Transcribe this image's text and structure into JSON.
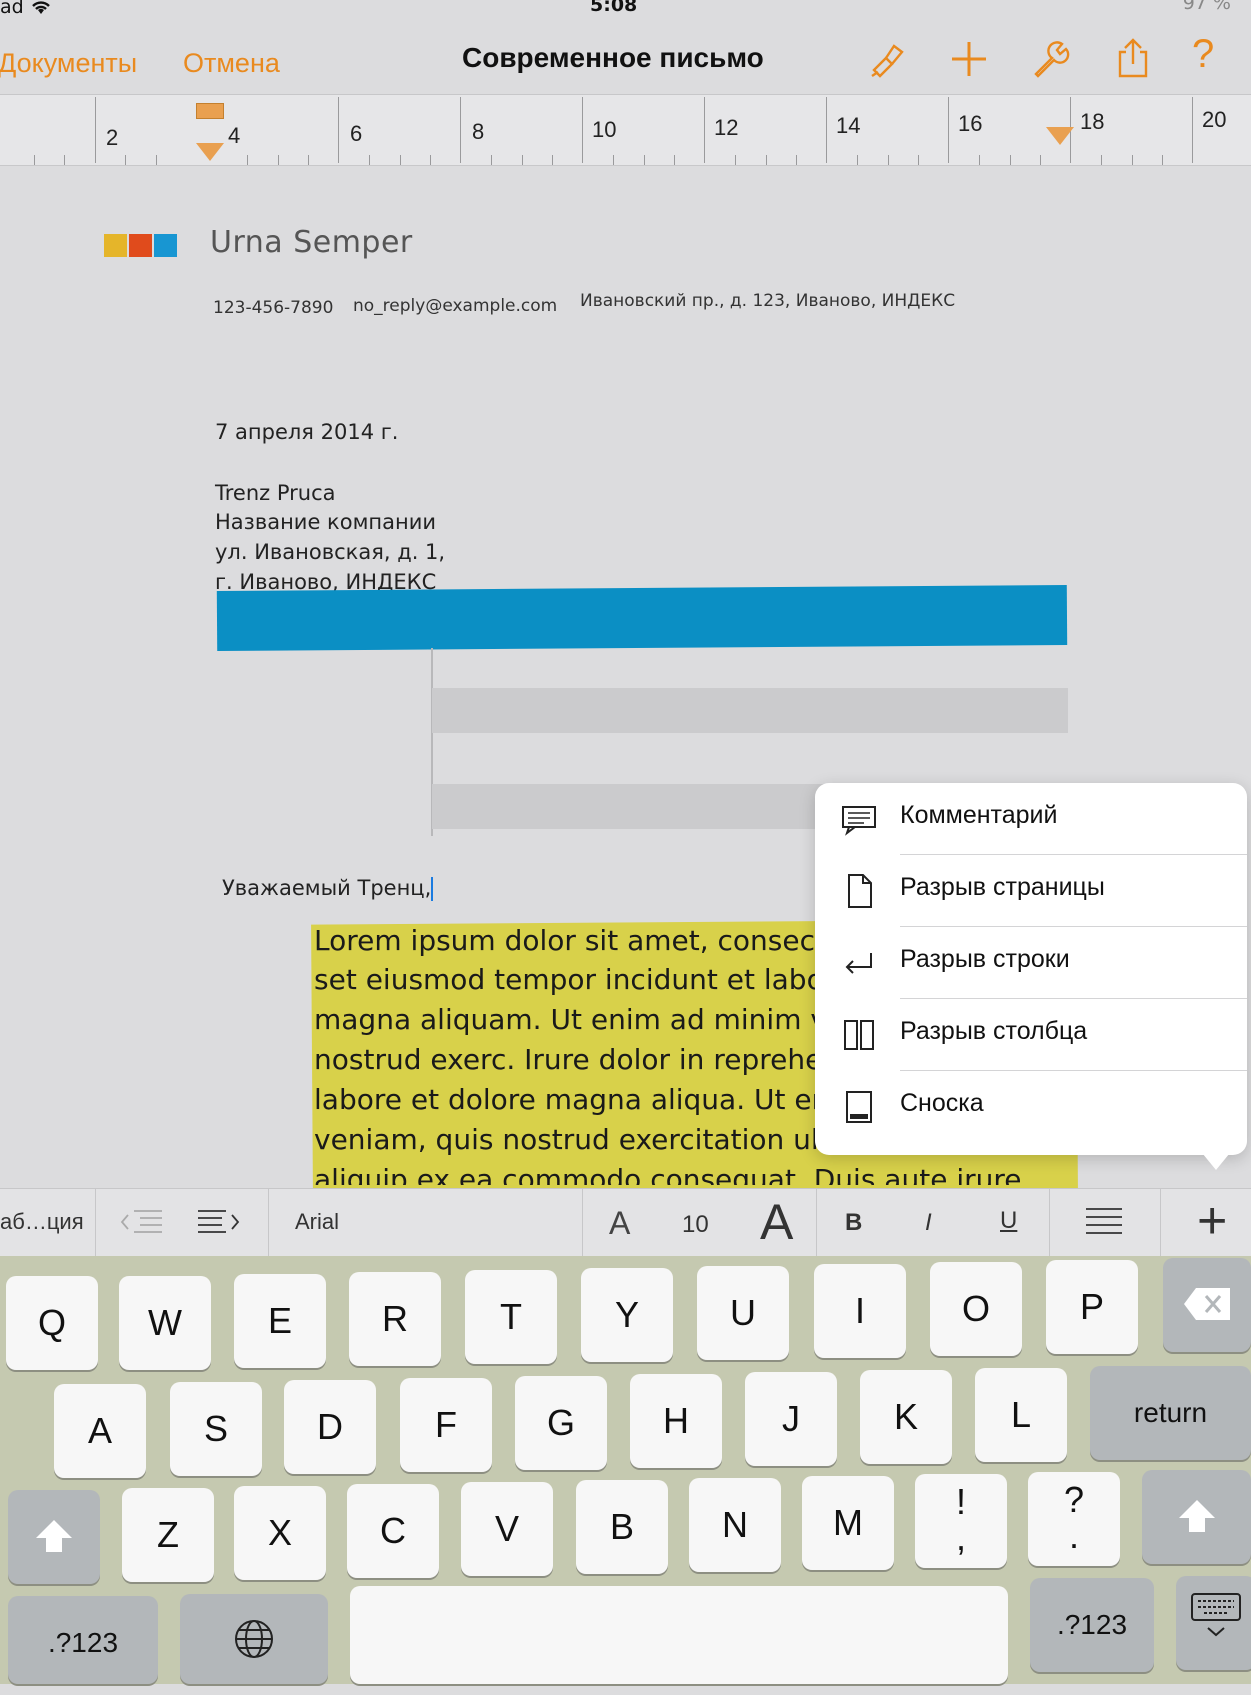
{
  "status_bar": {
    "carrier": "ad",
    "time": "5:08",
    "battery": "97 %"
  },
  "nav": {
    "documents": "Документы",
    "cancel": "Отмена",
    "title": "Современное письмо",
    "icons": [
      "paintbrush-icon",
      "plus-icon",
      "wrench-icon",
      "share-icon",
      "help-icon"
    ],
    "help_glyph": "?"
  },
  "ruler": {
    "numbers": [
      "2",
      "4",
      "6",
      "8",
      "10",
      "12",
      "14",
      "16",
      "18",
      "20"
    ]
  },
  "document": {
    "logo_colors": [
      "#e5b52a",
      "#e04b1c",
      "#1896d2"
    ],
    "sender_name": "Urna Semper",
    "phone": "123-456-7890",
    "email": "no_reply@example.com",
    "address": "Ивановский пр., д. 123,  Иваново, ИНДЕКС",
    "date": "7 апреля 2014 г.",
    "recipient": [
      "Trenz Pruca",
      "Название компании",
      "ул. Ивановская, д. 1,",
      "г. Иваново, ИНДЕКС"
    ],
    "greeting": "Уважаемый Тренц,",
    "body_lines": [
      "Lorem ipsum dolor sit amet, consecte",
      "set eiusmod tempor incidunt et labor",
      "magna aliquam. Ut enim ad minim ve",
      "nostrud exerc. Irure dolor in repreher",
      "labore et dolore magna aliqua. Ut en",
      "veniam, quis nostrud exercitation ulla",
      "aliquip ex ea commodo consequat. Duis aute irure"
    ],
    "accent_color": "#0b8fc4",
    "highlight_color": "#d8d14a"
  },
  "insert_menu": {
    "items": [
      {
        "label": "Комментарий",
        "icon": "comment-icon"
      },
      {
        "label": "Разрыв страницы",
        "icon": "page-break-icon"
      },
      {
        "label": "Разрыв строки",
        "icon": "line-break-icon"
      },
      {
        "label": "Разрыв столбца",
        "icon": "column-break-icon"
      },
      {
        "label": "Сноска",
        "icon": "footnote-icon"
      }
    ]
  },
  "format_bar": {
    "tab": "аб…ция",
    "font": "Arial",
    "font_small": "A",
    "font_size": "10",
    "font_large": "A",
    "bold": "B",
    "italic": "I",
    "underline": "U",
    "insert": "+"
  },
  "keyboard": {
    "row1": [
      "Q",
      "W",
      "E",
      "R",
      "T",
      "Y",
      "U",
      "I",
      "O",
      "P"
    ],
    "row2": [
      "A",
      "S",
      "D",
      "F",
      "G",
      "H",
      "J",
      "K",
      "L"
    ],
    "return": "return",
    "row3": [
      "Z",
      "X",
      "C",
      "V",
      "B",
      "N",
      "M"
    ],
    "punct1_top": "!",
    "punct1_bottom": ",",
    "punct2_top": "?",
    "punct2_bottom": ".",
    "numbers": ".?123"
  }
}
